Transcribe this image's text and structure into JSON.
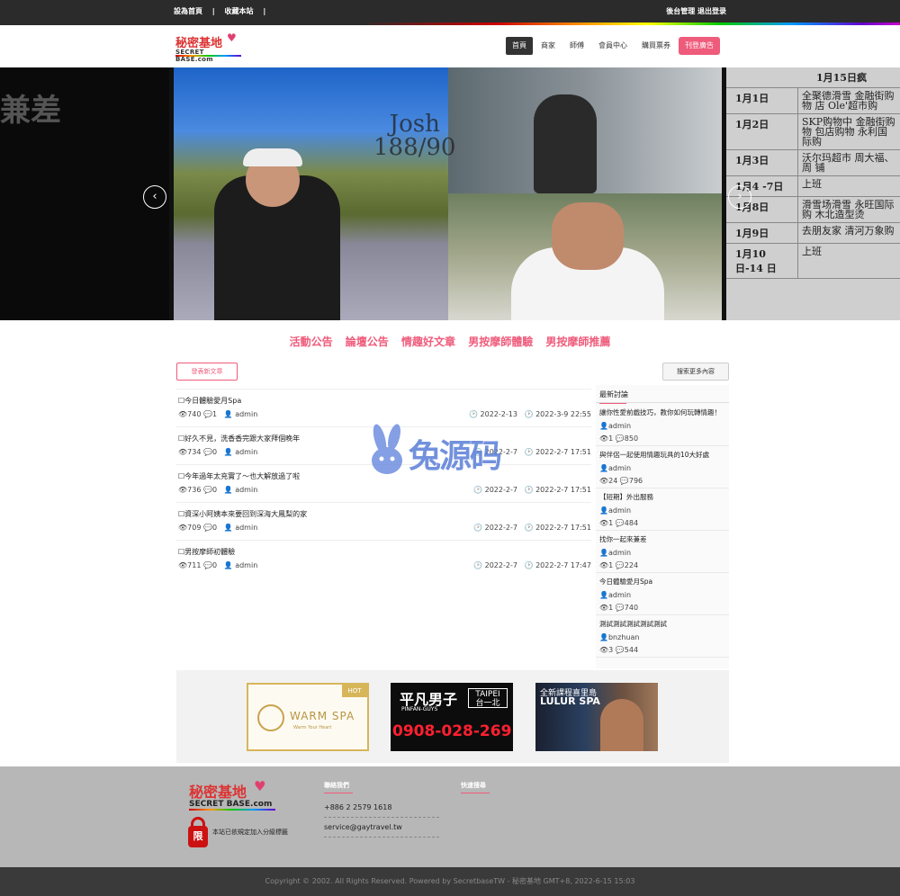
{
  "topbar": {
    "set_home": "設為首頁",
    "sep": "|",
    "bookmark": "收藏本站",
    "admin": "後台管理",
    "logout": "退出登录"
  },
  "logo": {
    "line1": "秘密基地",
    "line2": "SECRET BASE.com"
  },
  "nav": {
    "items": [
      "首頁",
      "商家",
      "師傅",
      "會員中心",
      "購買票券"
    ],
    "cta": "刊登廣告"
  },
  "slider": {
    "left_text": "兼差",
    "caption_line1": "Josh",
    "caption_line2": "188/90",
    "prev": "‹",
    "next": "›",
    "schedule": [
      {
        "date": "1月15日疯",
        "text": ""
      },
      {
        "date": "1月1日",
        "text": "全聚德滑雪 金融街购物 店 Ole'超市购"
      },
      {
        "date": "1月2日",
        "text": "SKP购物中 金融街购物 包店购物 永利国际购"
      },
      {
        "date": "1月3日",
        "text": "沃尔玛超市 周大福、周 铺"
      },
      {
        "date": "1月4 -7日",
        "text": "上班"
      },
      {
        "date": "1月8日",
        "text": "滑雪场滑雪 永旺国际购 木北造型烫"
      },
      {
        "date": "1月9日",
        "text": "去朋友家 清河万象购"
      },
      {
        "date": "1月10 日-14 日",
        "text": "上班"
      }
    ]
  },
  "categories": [
    "活動公告",
    "論壇公告",
    "情趣好文章",
    "男按摩師體驗",
    "男按摩師推薦"
  ],
  "buttons": {
    "new_post": "發表新文章",
    "search_more": "搜索更多內容"
  },
  "topics": [
    {
      "title": "今日體驗愛月Spa",
      "views": "740",
      "replies": "1",
      "author": "admin",
      "posted": "2022-2-13",
      "last": "2022-3-9 22:55"
    },
    {
      "title": "好久不見，洗香香完跟大家拜個晚年",
      "views": "734",
      "replies": "0",
      "author": "admin",
      "posted": "2022-2-7",
      "last": "2022-2-7 17:51"
    },
    {
      "title": "今年過年太充實了～也大解放過了啦",
      "views": "736",
      "replies": "0",
      "author": "admin",
      "posted": "2022-2-7",
      "last": "2022-2-7 17:51"
    },
    {
      "title": "資深小阿姨本來要回到深海大鳳梨的家",
      "views": "709",
      "replies": "0",
      "author": "admin",
      "posted": "2022-2-7",
      "last": "2022-2-7 17:51"
    },
    {
      "title": "男按摩師初體驗",
      "views": "711",
      "replies": "0",
      "author": "admin",
      "posted": "2022-2-7",
      "last": "2022-2-7 17:47"
    }
  ],
  "sidebar": {
    "heading": "最新討論",
    "items": [
      {
        "title": "讓你性愛前戲技巧，教你如何玩轉情趣！",
        "author": "admin",
        "views": "1",
        "replies": "850"
      },
      {
        "title": "與伴侶一起使用情趣玩具的10大好處",
        "author": "admin",
        "views": "24",
        "replies": "796"
      },
      {
        "title": "【短期】外出服務",
        "author": "admin",
        "views": "1",
        "replies": "484"
      },
      {
        "title": "找你一起來兼差",
        "author": "admin",
        "views": "1",
        "replies": "224"
      },
      {
        "title": "今日體驗愛月Spa",
        "author": "admin",
        "views": "1",
        "replies": "740"
      },
      {
        "title": "測試測試測試測試測試",
        "author": "bnzhuan",
        "views": "3",
        "replies": "544"
      }
    ]
  },
  "watermark": {
    "text": "兔源码"
  },
  "ads": {
    "ad1": {
      "title": "WARM SPA",
      "sub": "Warm Your Heart",
      "badge": "HOT"
    },
    "ad2": {
      "title": "平凡男子",
      "sub": "PINFAN-GUYS",
      "city_en": "TAIPEI",
      "city": "台一北",
      "phone": "0908-028-269"
    },
    "ad3": {
      "top": "全新課程喜里島",
      "title": "LULUR SPA"
    }
  },
  "footer": {
    "lock_badge": "限",
    "lock_text": "本站已依規定加入分級標籤",
    "contact_heading": "聯絡我們",
    "phone": "+886 2 2579 1618",
    "email": "service@gaytravel.tw",
    "quick_heading": "快速搜尋",
    "copyright": "Copyright © 2002. All Rights Reserved. Powered by SecretbaseTW - 秘密基地 GMT+8, 2022-6-15 15:03"
  },
  "colors": {
    "accent": "#ef5b7b",
    "dark": "#2b2b2b",
    "footer": "#b7b7b7"
  }
}
